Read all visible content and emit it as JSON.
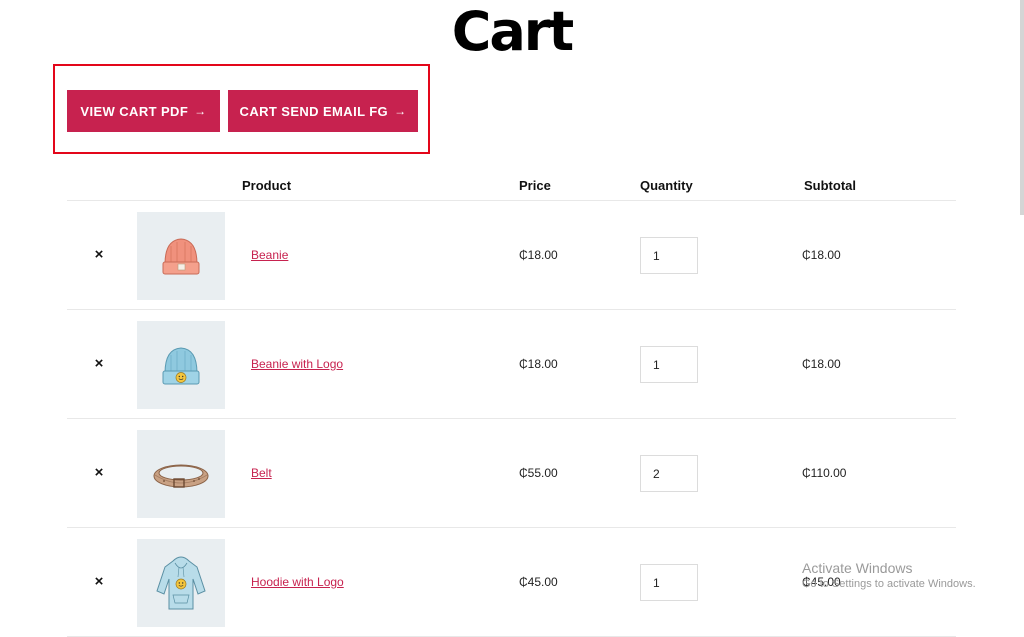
{
  "page": {
    "title": "Cart"
  },
  "actions": {
    "view_pdf_label": "VIEW CART PDF",
    "send_email_label": "CART SEND EMAIL FG",
    "arrow": "→",
    "highlight_color": "#e3061a",
    "button_color": "#c7224f"
  },
  "table": {
    "headers": {
      "product": "Product",
      "price": "Price",
      "quantity": "Quantity",
      "subtotal": "Subtotal"
    },
    "remove_glyph": "×",
    "rows": [
      {
        "name": "Beanie",
        "price": "₵18.00",
        "quantity": "1",
        "subtotal": "₵18.00",
        "image": "orange-beanie-image"
      },
      {
        "name": "Beanie with Logo",
        "price": "₵18.00",
        "quantity": "1",
        "subtotal": "₵18.00",
        "image": "blue-beanie-logo-image"
      },
      {
        "name": "Belt",
        "price": "₵55.00",
        "quantity": "2",
        "subtotal": "₵110.00",
        "image": "belt-image"
      },
      {
        "name": "Hoodie with Logo",
        "price": "₵45.00",
        "quantity": "1",
        "subtotal": "₵45.00",
        "image": "hoodie-logo-image"
      }
    ]
  },
  "watermark": {
    "line1": "Activate Windows",
    "line2": "Go to Settings to activate Windows."
  }
}
